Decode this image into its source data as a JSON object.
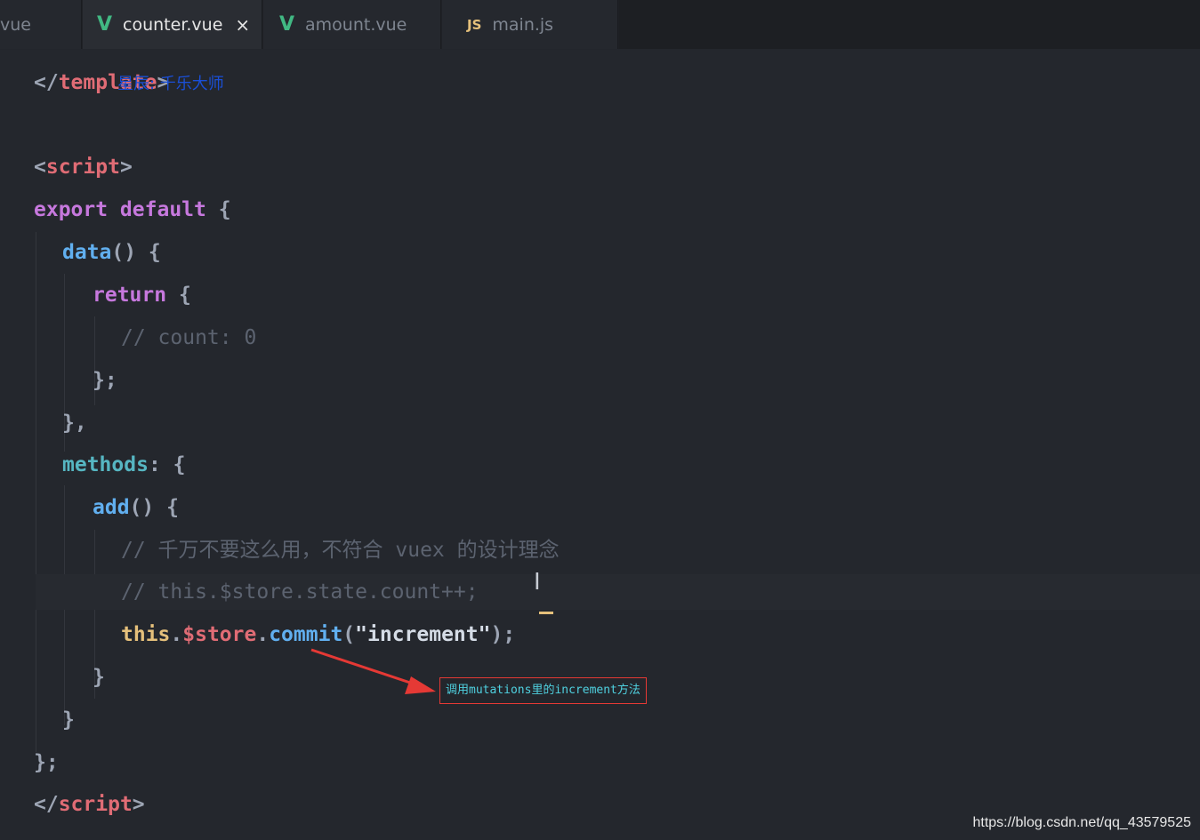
{
  "tabs": [
    {
      "label": "vue",
      "icon": "",
      "active": false
    },
    {
      "label": "counter.vue",
      "icon": "vue-icon",
      "active": true,
      "close": "×"
    },
    {
      "label": "amount.vue",
      "icon": "vue-icon",
      "active": false
    },
    {
      "label": "main.js",
      "icon": "js-icon",
      "active": false
    }
  ],
  "icons": {
    "vue": "V",
    "js": "JS"
  },
  "overlay_text": "星辰: 千乐大师",
  "code": {
    "l1": {
      "open": "</",
      "tag": "template",
      "close": ">"
    },
    "l3": {
      "open": "<",
      "tag": "script",
      "close": ">"
    },
    "l4": {
      "kw": "export default",
      "punc": " {"
    },
    "l5": {
      "fn": "data",
      "punc": "() {"
    },
    "l6": {
      "kw": "return",
      "punc": " {"
    },
    "l7": {
      "cm": "// count: 0"
    },
    "l8": {
      "punc": "};"
    },
    "l9": {
      "punc": "},"
    },
    "l10": {
      "prop": "methods",
      "punc": ": {"
    },
    "l11": {
      "fn": "add",
      "punc": "() {"
    },
    "l12": {
      "cm": "// 千万不要这么用，不符合 vuex 的设计理念"
    },
    "l13": {
      "cm": "// this.$store.state.count++;"
    },
    "l14": {
      "this": "this",
      "dot1": ".",
      "var": "$store",
      "dot2": ".",
      "fn": "commit",
      "p1": "(",
      "str": "\"increment\"",
      "p2": ");"
    },
    "l15": {
      "punc": "}"
    },
    "l16": {
      "punc": "}"
    },
    "l17": {
      "punc": "};"
    },
    "l18": {
      "open": "</",
      "tag": "script",
      "close": ">"
    }
  },
  "annotation": "调用mutations里的increment方法",
  "watermark": "https://blog.csdn.net/qq_43579525",
  "colors": {
    "tag": "#e06c75",
    "keyword": "#c678dd",
    "function": "#61afef",
    "comment": "#5c6370",
    "string": "#d5dce6",
    "annotation_border": "#e53935"
  }
}
